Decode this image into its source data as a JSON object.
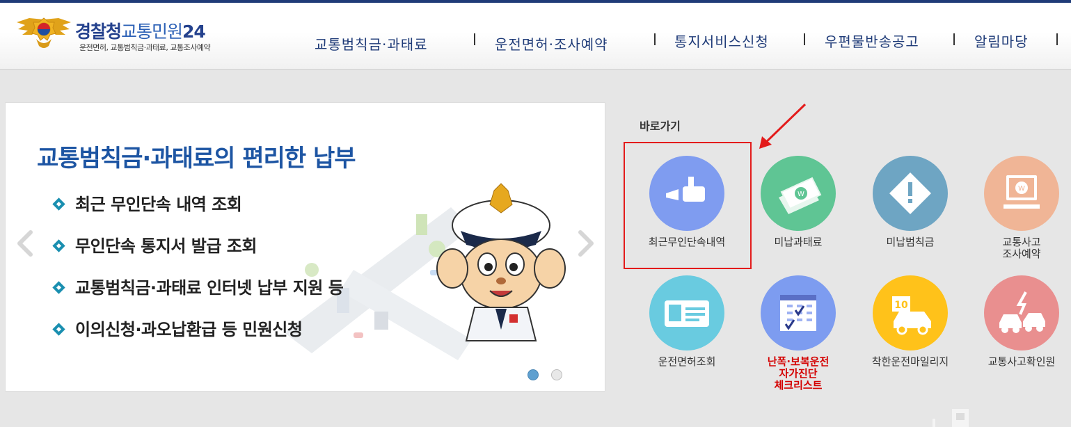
{
  "header": {
    "logo": {
      "title_part1": "경찰청",
      "title_part2": "교통민원",
      "title_part3": "24",
      "subtitle": "운전면허, 교통범칙금·과태료, 교통조사예약"
    },
    "nav": [
      {
        "label": "교통범칙금·과태료"
      },
      {
        "label": "운전면허·조사예약"
      },
      {
        "label": "통지서비스신청"
      },
      {
        "label": "우편물반송공고"
      },
      {
        "label": "알림마당"
      }
    ]
  },
  "banner": {
    "title": "교통범칙금·과태료의 편리한 납부",
    "bullets": [
      "최근 무인단속 내역 조회",
      "무인단속 통지서 발급 조회",
      "교통범칙금·과태료 인터넷 납부 지원 등",
      "이의신청·과오납환급 등 민원신청"
    ],
    "active_slide": 1,
    "slide_count": 2
  },
  "quick": {
    "title": "바로가기",
    "items": [
      {
        "label": "최근무인단속내역",
        "icon": "camera-icon",
        "color": "#7f9cf0"
      },
      {
        "label": "미납과태료",
        "icon": "money-icon",
        "color": "#5fc594"
      },
      {
        "label": "미납범칙금",
        "icon": "warning-diamond-icon",
        "color": "#6ea5c3"
      },
      {
        "label": "교통사고\n조사예약",
        "icon": "monitor-won-icon",
        "color": "#f0b596"
      },
      {
        "label": "운전면허조회",
        "icon": "license-card-icon",
        "color": "#69cbe0"
      },
      {
        "label": "난폭·보복운전\n자가진단\n체크리스트",
        "icon": "calendar-check-icon",
        "color": "#7d9cf0"
      },
      {
        "label": "착한운전마일리지",
        "icon": "car-ten-icon",
        "color": "#ffc21a"
      },
      {
        "label": "교통사고확인원",
        "icon": "car-crash-icon",
        "color": "#e98f8f"
      }
    ]
  },
  "colors": {
    "brand_navy": "#1f3b78",
    "banner_title": "#1d55a3",
    "highlight_red": "#e31b1b"
  }
}
